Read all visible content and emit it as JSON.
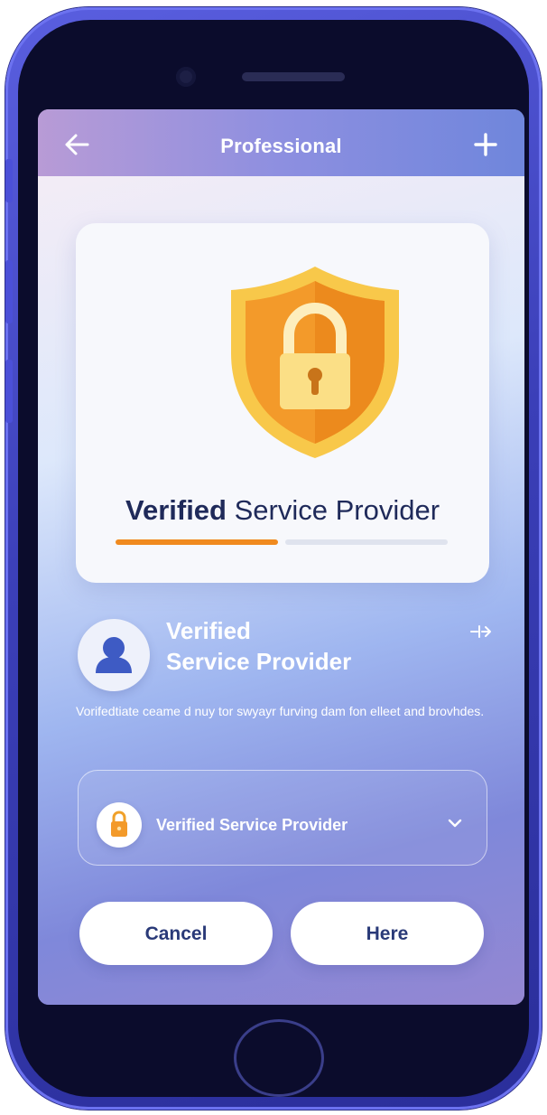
{
  "header": {
    "title": "Professional",
    "back_icon": "arrow-left-icon",
    "add_icon": "plus-icon"
  },
  "hero": {
    "icon": "shield-lock-icon",
    "title_bold": "Verified",
    "title_rest": " Service Provider",
    "progress_fraction": 0.49
  },
  "profile": {
    "avatar_icon": "user-icon",
    "name_line1": "Verified",
    "name_line2": "Service Provider",
    "action_icon": "arrow-right-icon",
    "action_text": "·I·>"
  },
  "description": "Vorifedtiate ceame d nuy tor swyayr furving dam fon elleet and brovhdes.",
  "select": {
    "icon": "lock-badge-icon",
    "label": "Verified Service Provider",
    "chevron_icon": "chevron-down-icon"
  },
  "buttons": {
    "cancel_label": "Cancel",
    "here_label": "Here"
  },
  "colors": {
    "accent_orange": "#f08a1f",
    "shield_yellow": "#f8c84a",
    "heading_navy": "#1f2a5a",
    "button_text": "#2a3a78"
  }
}
